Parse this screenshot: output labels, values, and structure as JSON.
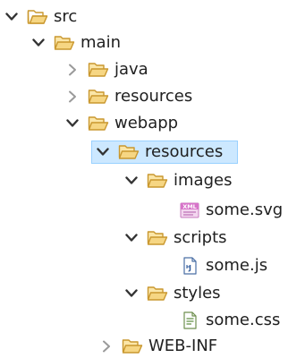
{
  "tree": {
    "items": [
      {
        "label": "src",
        "icon": "folder-icon",
        "state": "expanded"
      },
      {
        "label": "main",
        "icon": "folder-icon",
        "state": "expanded"
      },
      {
        "label": "java",
        "icon": "folder-icon",
        "state": "collapsed"
      },
      {
        "label": "resources",
        "icon": "folder-icon",
        "state": "collapsed"
      },
      {
        "label": "webapp",
        "icon": "folder-icon",
        "state": "expanded"
      },
      {
        "label": "resources",
        "icon": "folder-icon",
        "state": "expanded",
        "selected": true
      },
      {
        "label": "images",
        "icon": "folder-icon",
        "state": "expanded"
      },
      {
        "label": "some.svg",
        "icon": "xml-file-icon",
        "state": "leaf"
      },
      {
        "label": "scripts",
        "icon": "folder-icon",
        "state": "expanded"
      },
      {
        "label": "some.js",
        "icon": "js-file-icon",
        "state": "leaf"
      },
      {
        "label": "styles",
        "icon": "folder-icon",
        "state": "expanded"
      },
      {
        "label": "some.css",
        "icon": "css-file-icon",
        "state": "leaf"
      },
      {
        "label": "WEB-INF",
        "icon": "folder-icon",
        "state": "collapsed"
      }
    ]
  },
  "colors": {
    "selection_bg": "#cce8ff",
    "selection_border": "#99d1ff",
    "folder_fill": "#f6d683",
    "folder_outline": "#c9972e",
    "chevron_expanded": "#333333",
    "chevron_collapsed": "#9a9a9a"
  }
}
